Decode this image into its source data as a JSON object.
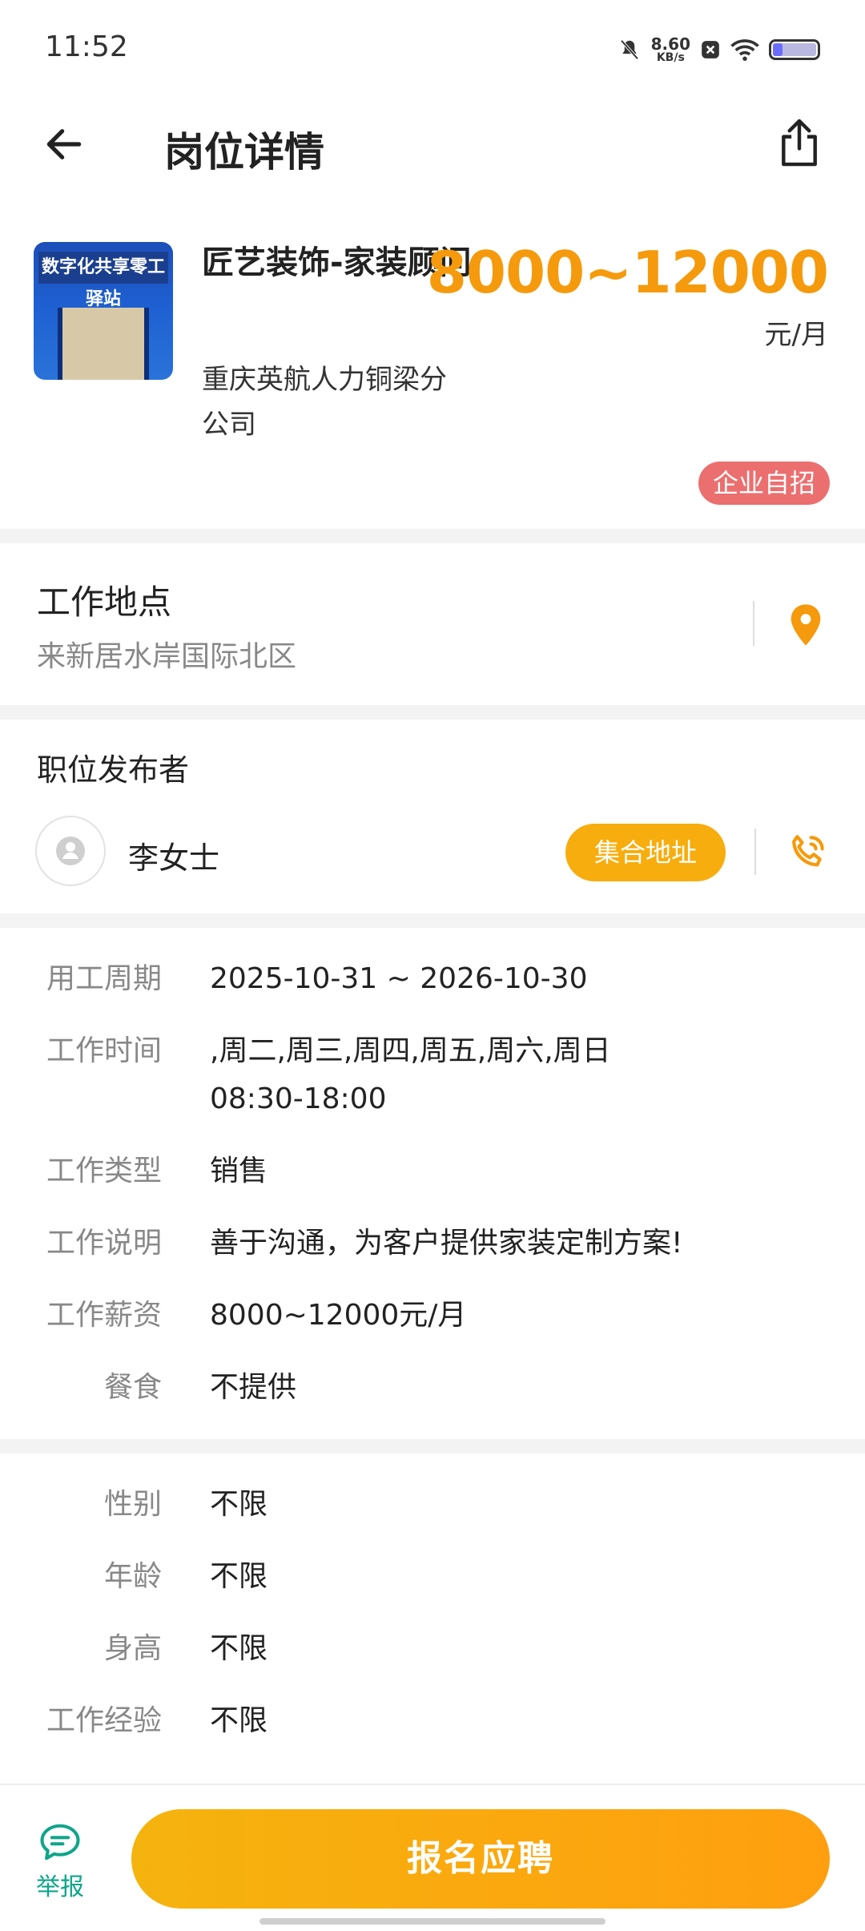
{
  "status_bar": {
    "time": "11:52",
    "net_speed_value": "8.60",
    "net_speed_unit": "KB/s",
    "icons": [
      "mute-icon",
      "close-box-icon",
      "wifi-icon",
      "battery-icon"
    ]
  },
  "header": {
    "title": "岗位详情"
  },
  "job": {
    "thumbnail_sign_text": "数字化共享零工驿站",
    "title": "匠艺装饰-家装顾问",
    "salary": "8000~12000",
    "salary_unit": "元/月",
    "company": "重庆英航人力铜梁分公司",
    "badge": "企业自招"
  },
  "location": {
    "title": "工作地点",
    "address": "来新居水岸国际北区"
  },
  "publisher": {
    "title": "职位发布者",
    "name": "李女士",
    "meet_button": "集合地址"
  },
  "details": [
    {
      "label": "用工周期",
      "value": "2025-10-31 ~ 2026-10-30"
    },
    {
      "label": "工作时间",
      "value": ",周二,周三,周四,周五,周六,周日",
      "value2": "08:30-18:00"
    },
    {
      "label": "工作类型",
      "value": "销售"
    },
    {
      "label": "工作说明",
      "value": "善于沟通，为客户提供家装定制方案!"
    },
    {
      "label": "工作薪资",
      "value": "8000~12000元/月"
    },
    {
      "label": "餐食",
      "value": "不提供"
    }
  ],
  "requirements": [
    {
      "label": "性别",
      "value": "不限"
    },
    {
      "label": "年龄",
      "value": "不限"
    },
    {
      "label": "身高",
      "value": "不限"
    },
    {
      "label": "工作经验",
      "value": "不限"
    }
  ],
  "bottom": {
    "report_label": "举报",
    "apply_button": "报名应聘"
  },
  "colors": {
    "accent_orange": "#f59a0c",
    "button_orange": "#f7ad0d",
    "badge_red": "#ec6f6f",
    "report_green": "#0ea58a"
  }
}
